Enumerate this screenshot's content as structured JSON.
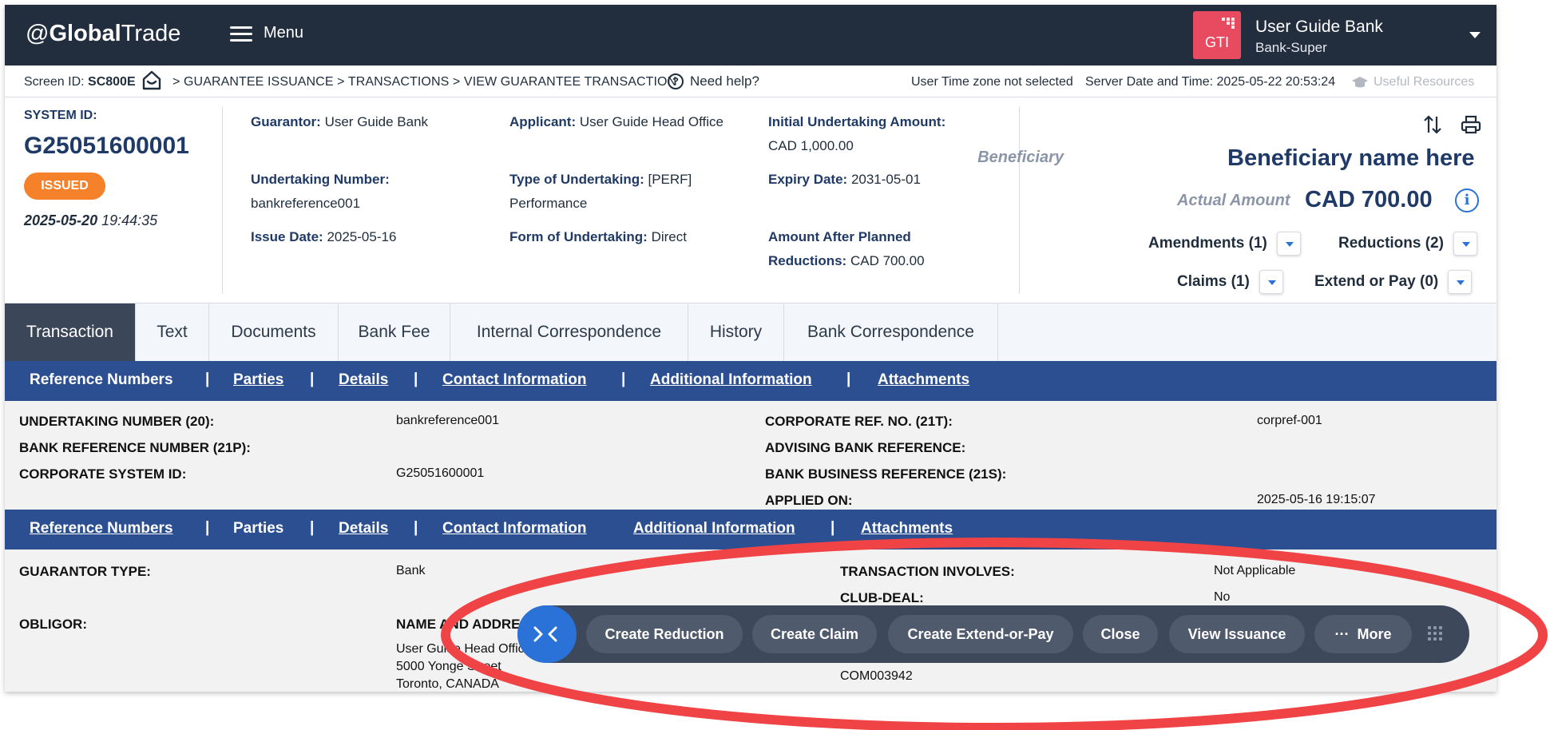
{
  "header": {
    "logo_at": "@",
    "logo_bold": "Global",
    "logo_light": "Trade",
    "menu_label": "Menu",
    "gti_label": "GTI",
    "user_name": "User Guide Bank",
    "user_role": "Bank-Super"
  },
  "infobar": {
    "screen_id_label": "Screen ID: ",
    "screen_id": "SC800E",
    "breadcrumb": ">  GUARANTEE ISSUANCE > TRANSACTIONS > VIEW GUARANTEE TRANSACTION",
    "help": "Need help?",
    "timezone": "User Time zone not selected",
    "server_time": "Server Date and Time: 2025-05-22 20:53:24",
    "useful_resources": "Useful Resources"
  },
  "summary": {
    "system_id_label": "SYSTEM ID:",
    "system_id": "G25051600001",
    "status": "ISSUED",
    "date": "2025-05-20",
    "time": "19:44:35",
    "guarantor_label": "Guarantor:",
    "guarantor": "User Guide Bank",
    "applicant_label": "Applicant:",
    "applicant": "User Guide Head Office",
    "initial_amount_label": "Initial Undertaking Amount:",
    "initial_amount": "CAD 1,000.00",
    "undertaking_number_label": "Undertaking Number:",
    "undertaking_number": "bankreference001",
    "type_label": "Type of Undertaking:",
    "type_code": "[PERF]",
    "type_name": "Performance",
    "expiry_label": "Expiry Date:",
    "expiry": "2031-05-01",
    "issue_label": "Issue Date:",
    "issue": "2025-05-16",
    "form_label": "Form of Undertaking:",
    "form": "Direct",
    "after_planned_label_1": "Amount After Planned",
    "after_planned_label_2": "Reductions:",
    "after_planned": "CAD 700.00",
    "beneficiary_label": "Beneficiary",
    "beneficiary": "Beneficiary name here",
    "actual_amount_label": "Actual Amount",
    "actual_amount": "CAD 700.00",
    "amendments": "Amendments (1)",
    "reductions": "Reductions (2)",
    "claims": "Claims (1)",
    "extend_or_pay": "Extend or Pay (0)"
  },
  "tabs": [
    "Transaction",
    "Text",
    "Documents",
    "Bank Fee",
    "Internal Correspondence",
    "History",
    "Bank Correspondence"
  ],
  "section_nav": [
    "Reference Numbers",
    "Parties",
    "Details",
    "Contact Information",
    "Additional Information",
    "Attachments"
  ],
  "reference_numbers": {
    "undertaking_number_label": "UNDERTAKING NUMBER (20):",
    "undertaking_number": "bankreference001",
    "bank_ref_label": "BANK REFERENCE NUMBER (21P):",
    "corporate_sys_label": "CORPORATE SYSTEM ID:",
    "corporate_sys": "G25051600001",
    "corporate_ref_label": "CORPORATE REF. NO. (21T):",
    "corporate_ref": "corpref-001",
    "advising_label": "ADVISING BANK REFERENCE:",
    "bank_business_label": "BANK BUSINESS REFERENCE (21S):",
    "applied_on_label": "APPLIED ON:",
    "applied_on": "2025-05-16 19:15:07"
  },
  "parties": {
    "guarantor_type_label": "GUARANTOR TYPE:",
    "guarantor_type": "Bank",
    "transaction_involves_label": "TRANSACTION INVOLVES:",
    "transaction_involves": "Not Applicable",
    "club_deal_label": "CLUB-DEAL:",
    "club_deal": "No",
    "obligor_label": "OBLIGOR:",
    "name_address_label": "NAME AND ADDRESS:",
    "address_line1": "User Guide Head Office",
    "address_line2": "5000 Yonge Street",
    "address_line3": "Toronto, CANADA",
    "customer_id": "COM003942"
  },
  "actions": {
    "create_reduction": "Create Reduction",
    "create_claim": "Create Claim",
    "create_extend_or_pay": "Create Extend-or-Pay",
    "close": "Close",
    "view_issuance": "View Issuance",
    "more": "More"
  },
  "colors": {
    "header_bg": "#222d3e",
    "section_nav_bg": "#2c4f92",
    "status_badge": "#f5822a",
    "gti_badge": "#e84a5f",
    "accent_blue": "#2a72d8",
    "action_bar_bg": "#3d485a",
    "highlight_oval": "#f04346"
  },
  "icons": [
    "hamburger-icon",
    "home-icon",
    "help-icon",
    "graduation-cap-icon",
    "sort-icon",
    "print-icon",
    "info-icon",
    "chevron-down-icon",
    "collapse-chevrons-icon",
    "ellipsis-icon",
    "drag-grip-icon"
  ]
}
